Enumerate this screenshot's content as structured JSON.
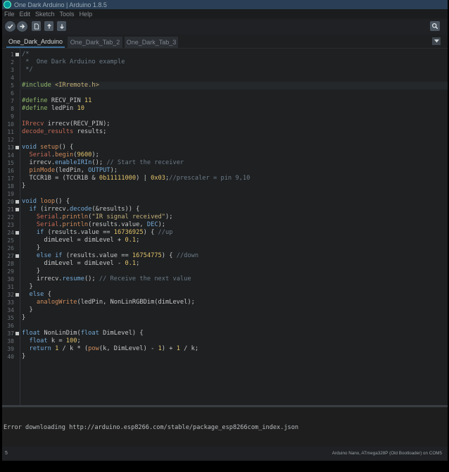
{
  "window": {
    "title": "One Dark Arduino | Arduino 1.8.5"
  },
  "menu": [
    "File",
    "Edit",
    "Sketch",
    "Tools",
    "Help"
  ],
  "toolbar": {
    "buttons": [
      "verify-icon",
      "upload-icon",
      "new-icon",
      "open-icon",
      "save-icon",
      "serial-monitor-icon"
    ]
  },
  "tabs": [
    "One_Dark_Arduino",
    "One_Dark_Tab_2",
    "One_Dark_Tab_3"
  ],
  "active_tab": "One_Dark_Arduino",
  "editor": {
    "current_line": 5,
    "lines": [
      {
        "n": "1",
        "fold": true,
        "tokens": [
          [
            "c",
            "/*"
          ]
        ]
      },
      {
        "n": "2",
        "tokens": [
          [
            "c",
            " *  One Dark Arduino example"
          ]
        ]
      },
      {
        "n": "3",
        "tokens": [
          [
            "c",
            " */"
          ]
        ]
      },
      {
        "n": "4",
        "tokens": []
      },
      {
        "n": "5",
        "tokens": [
          [
            "pp",
            "#include "
          ],
          [
            "st",
            "<IRremote.h>"
          ]
        ]
      },
      {
        "n": "6",
        "tokens": []
      },
      {
        "n": "7",
        "tokens": [
          [
            "pp",
            "#define "
          ],
          [
            "id",
            "RECV_PIN "
          ],
          [
            "nm",
            "11"
          ]
        ]
      },
      {
        "n": "8",
        "tokens": [
          [
            "pp",
            "#define "
          ],
          [
            "id",
            "ledPin "
          ],
          [
            "nm",
            "10"
          ]
        ]
      },
      {
        "n": "9",
        "tokens": []
      },
      {
        "n": "10",
        "tokens": [
          [
            "ty",
            "IRrecv"
          ],
          [
            "id",
            " irrecv(RECV_PIN);"
          ]
        ]
      },
      {
        "n": "11",
        "tokens": [
          [
            "ty",
            "decode_results"
          ],
          [
            "id",
            " results;"
          ]
        ]
      },
      {
        "n": "12",
        "tokens": []
      },
      {
        "n": "13",
        "fold": true,
        "tokens": [
          [
            "kw",
            "void "
          ],
          [
            "fn",
            "setup"
          ],
          [
            "id",
            "() {"
          ]
        ]
      },
      {
        "n": "14",
        "tokens": [
          [
            "id",
            "  "
          ],
          [
            "ty",
            "Serial"
          ],
          [
            "id",
            "."
          ],
          [
            "fn",
            "begin"
          ],
          [
            "id",
            "("
          ],
          [
            "nm",
            "9600"
          ],
          [
            "id",
            ");"
          ]
        ]
      },
      {
        "n": "15",
        "tokens": [
          [
            "id",
            "  irrecv."
          ],
          [
            "kw",
            "enableIRIn"
          ],
          [
            "id",
            "(); "
          ],
          [
            "c",
            "// Start the receiver"
          ]
        ]
      },
      {
        "n": "16",
        "tokens": [
          [
            "id",
            "  "
          ],
          [
            "fn",
            "pinMode"
          ],
          [
            "id",
            "(ledPin, "
          ],
          [
            "kw",
            "OUTPUT"
          ],
          [
            "id",
            ");"
          ]
        ]
      },
      {
        "n": "17",
        "tokens": [
          [
            "id",
            "  TCCR1B = (TCCR1B & "
          ],
          [
            "nm",
            "0b11111000"
          ],
          [
            "id",
            ") | "
          ],
          [
            "nm",
            "0x03"
          ],
          [
            "id",
            ";"
          ],
          [
            "c",
            "//prescaler = pin 9,10"
          ]
        ]
      },
      {
        "n": "18",
        "tokens": [
          [
            "id",
            "}"
          ]
        ]
      },
      {
        "n": "19",
        "tokens": []
      },
      {
        "n": "20",
        "fold": true,
        "tokens": [
          [
            "kw",
            "void "
          ],
          [
            "fn",
            "loop"
          ],
          [
            "id",
            "() {"
          ]
        ]
      },
      {
        "n": "21",
        "fold": true,
        "tokens": [
          [
            "id",
            "  "
          ],
          [
            "kw",
            "if "
          ],
          [
            "id",
            "(irrecv."
          ],
          [
            "kw",
            "decode"
          ],
          [
            "id",
            "(&results)) {"
          ]
        ]
      },
      {
        "n": "22",
        "tokens": [
          [
            "id",
            "    "
          ],
          [
            "ty",
            "Serial"
          ],
          [
            "id",
            "."
          ],
          [
            "fn",
            "println"
          ],
          [
            "id",
            "("
          ],
          [
            "st",
            "\"IR signal received\""
          ],
          [
            "id",
            ");"
          ]
        ]
      },
      {
        "n": "23",
        "tokens": [
          [
            "id",
            "    "
          ],
          [
            "ty",
            "Serial"
          ],
          [
            "id",
            "."
          ],
          [
            "fn",
            "println"
          ],
          [
            "id",
            "(results.value, "
          ],
          [
            "kw",
            "DEC"
          ],
          [
            "id",
            ");"
          ]
        ]
      },
      {
        "n": "24",
        "fold": true,
        "tokens": [
          [
            "id",
            "    "
          ],
          [
            "kw",
            "if "
          ],
          [
            "id",
            "(results.value == "
          ],
          [
            "nm",
            "16736925"
          ],
          [
            "id",
            ") { "
          ],
          [
            "c",
            "//up"
          ]
        ]
      },
      {
        "n": "25",
        "tokens": [
          [
            "id",
            "      dimLevel = dimLevel + "
          ],
          [
            "nm",
            "0.1"
          ],
          [
            "id",
            ";"
          ]
        ]
      },
      {
        "n": "26",
        "tokens": [
          [
            "id",
            "    }"
          ]
        ]
      },
      {
        "n": "27",
        "fold": true,
        "tokens": [
          [
            "id",
            "    "
          ],
          [
            "kw",
            "else if "
          ],
          [
            "id",
            "(results.value == "
          ],
          [
            "nm",
            "16754775"
          ],
          [
            "id",
            ") { "
          ],
          [
            "c",
            "//down"
          ]
        ]
      },
      {
        "n": "28",
        "tokens": [
          [
            "id",
            "      dimLevel = dimLevel - "
          ],
          [
            "nm",
            "0.1"
          ],
          [
            "id",
            ";"
          ]
        ]
      },
      {
        "n": "29",
        "tokens": [
          [
            "id",
            "    }"
          ]
        ]
      },
      {
        "n": "30",
        "tokens": [
          [
            "id",
            "    irrecv."
          ],
          [
            "kw",
            "resume"
          ],
          [
            "id",
            "(); "
          ],
          [
            "c",
            "// Receive the next value"
          ]
        ]
      },
      {
        "n": "31",
        "tokens": [
          [
            "id",
            "  }"
          ]
        ]
      },
      {
        "n": "32",
        "fold": true,
        "tokens": [
          [
            "id",
            "  "
          ],
          [
            "kw",
            "else "
          ],
          [
            "id",
            "{"
          ]
        ]
      },
      {
        "n": "33",
        "tokens": [
          [
            "id",
            "    "
          ],
          [
            "fn",
            "analogWrite"
          ],
          [
            "id",
            "(ledPin, NonLinRGBDim(dimLevel);"
          ]
        ]
      },
      {
        "n": "34",
        "tokens": [
          [
            "id",
            "  }"
          ]
        ]
      },
      {
        "n": "35",
        "tokens": [
          [
            "id",
            "}"
          ]
        ]
      },
      {
        "n": "36",
        "tokens": []
      },
      {
        "n": "37",
        "fold": true,
        "tokens": [
          [
            "kw",
            "float "
          ],
          [
            "id",
            "NonLinDim("
          ],
          [
            "kw",
            "float "
          ],
          [
            "id",
            "DimLevel) {"
          ]
        ]
      },
      {
        "n": "38",
        "tokens": [
          [
            "id",
            "  "
          ],
          [
            "kw",
            "float "
          ],
          [
            "id",
            "k = "
          ],
          [
            "nm",
            "100"
          ],
          [
            "id",
            ";"
          ]
        ]
      },
      {
        "n": "39",
        "tokens": [
          [
            "id",
            "  "
          ],
          [
            "kw",
            "return "
          ],
          [
            "nm",
            "1"
          ],
          [
            "id",
            " / k * ("
          ],
          [
            "fn",
            "pow"
          ],
          [
            "id",
            "(k, DimLevel) - "
          ],
          [
            "nm",
            "1"
          ],
          [
            "id",
            ") + "
          ],
          [
            "nm",
            "1"
          ],
          [
            "id",
            " / k;"
          ]
        ]
      },
      {
        "n": "40",
        "tokens": [
          [
            "id",
            "}"
          ]
        ]
      }
    ]
  },
  "console": {
    "message": "Error downloading http://arduino.esp8266.com/stable/package_esp8266com_index.json"
  },
  "status": {
    "line": "5",
    "board": "Arduino Nano, ATmega328P (Old Bootloader) on COM5"
  },
  "colors": {
    "background": "#1e2022",
    "accent": "#3c6e9a",
    "keyword": "#74a9d6",
    "comment": "#6c7a86",
    "number": "#e0c16a",
    "type": "#c66a55",
    "function": "#d08c5a",
    "preprocessor": "#8fb86a"
  }
}
